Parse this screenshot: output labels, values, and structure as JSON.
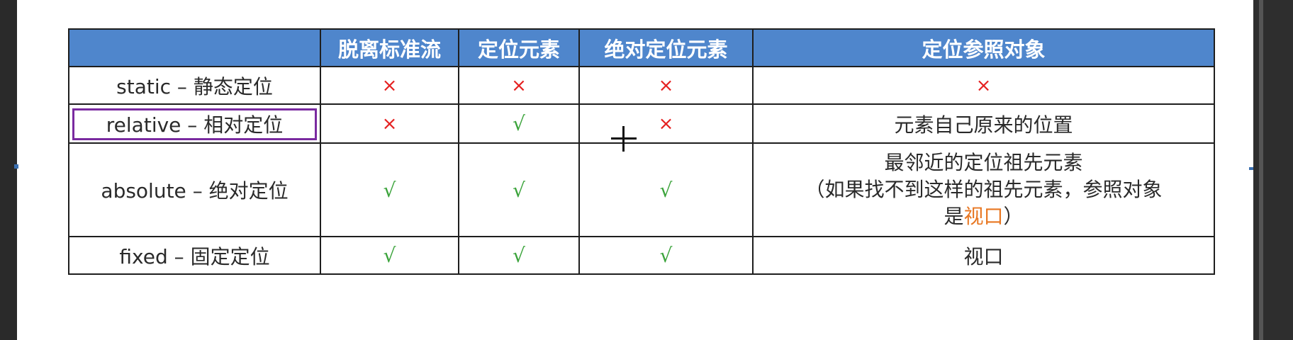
{
  "table": {
    "headers": [
      "",
      "脱离标准流",
      "定位元素",
      "绝对定位元素",
      "定位参照对象"
    ],
    "rows": [
      {
        "name": "static – 静态定位",
        "out_of_flow": "×",
        "positioned": "×",
        "absolutely_positioned": "×",
        "reference": "×"
      },
      {
        "name": "relative – 相对定位",
        "out_of_flow": "×",
        "positioned": "√",
        "absolutely_positioned": "×",
        "reference": "元素自己原来的位置"
      },
      {
        "name": "absolute – 绝对定位",
        "out_of_flow": "√",
        "positioned": "√",
        "absolutely_positioned": "√",
        "reference_line1": "最邻近的定位祖先元素",
        "reference_line2": "（如果找不到这样的祖先元素，参照对象",
        "reference_line3_prefix": "是",
        "reference_line3_highlight": "视口",
        "reference_line3_suffix": "）"
      },
      {
        "name": "fixed – 固定定位",
        "out_of_flow": "√",
        "positioned": "√",
        "absolutely_positioned": "√",
        "reference": "视口"
      }
    ]
  },
  "colors": {
    "header_bg": "#4f86cc",
    "cross": "#e52020",
    "check": "#3aa33a",
    "highlight_text": "#e87722",
    "selection_box": "#7a2aa0"
  },
  "cursor_icon": "crosshair-plus-icon"
}
